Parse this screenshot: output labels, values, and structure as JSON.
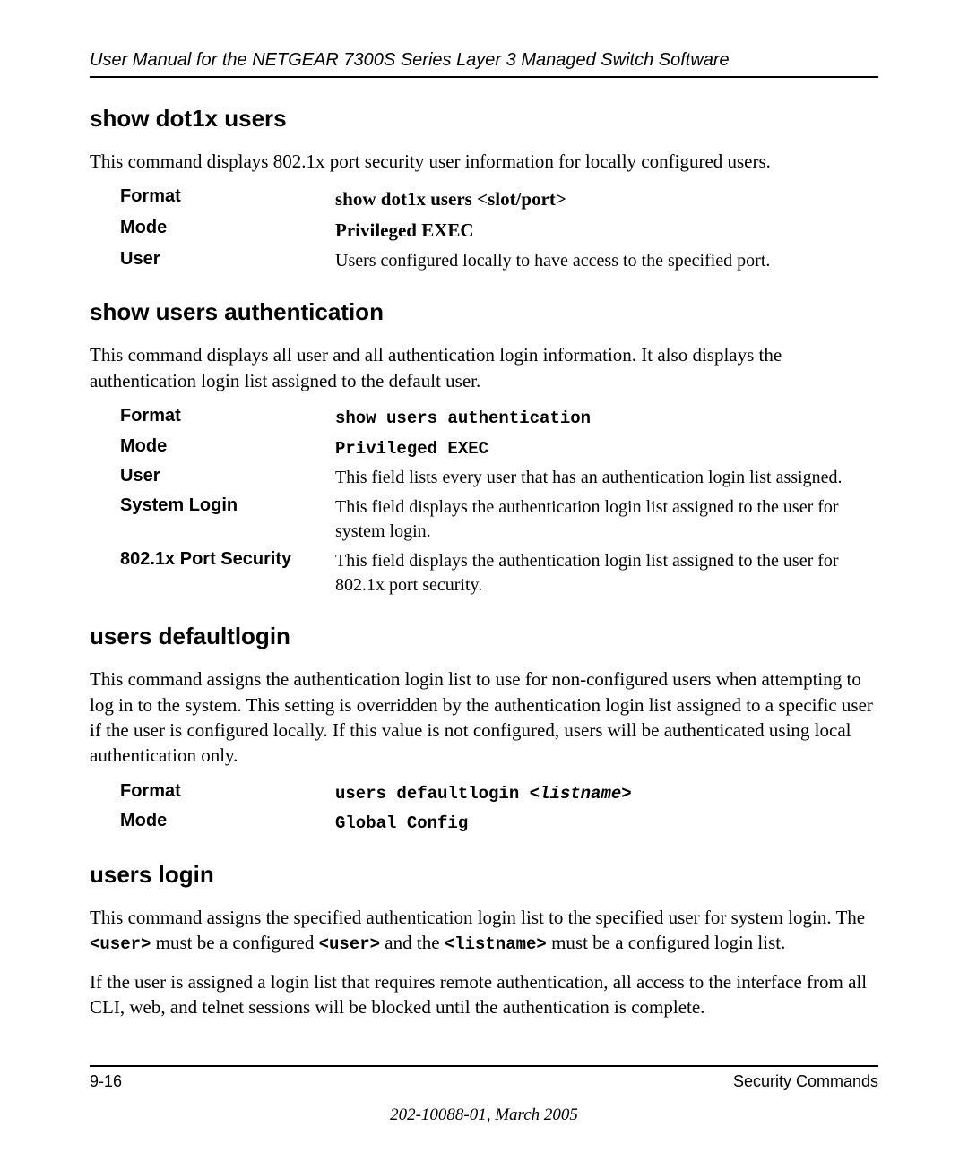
{
  "header": {
    "running_title": "User Manual for the NETGEAR 7300S Series Layer 3 Managed Switch Software"
  },
  "sections": {
    "show_dot1x_users": {
      "title": "show dot1x users",
      "intro": "This command displays 802.1x port security user information for locally configured users.",
      "rows": {
        "format_label": "Format",
        "format_value": "show dot1x users <slot/port>",
        "mode_label": "Mode",
        "mode_value": "Privileged EXEC",
        "user_label": "User",
        "user_value": "Users configured locally to have access to the specified port."
      }
    },
    "show_users_auth": {
      "title": "show users authentication",
      "intro": "This command displays all user and all authentication login information. It also displays the authentication login list assigned to the default user.",
      "rows": {
        "format_label": "Format",
        "format_value": "show users authentication",
        "mode_label": "Mode",
        "mode_value": "Privileged EXEC",
        "user_label": "User",
        "user_value": "This field lists every user that has an authentication login list assigned.",
        "syslogin_label": "System Login",
        "syslogin_value": "This field displays the authentication login list assigned to the user for system login.",
        "portsec_label": "802.1x Port Security",
        "portsec_value": "This field displays the authentication login list assigned to the user for 802.1x port security."
      }
    },
    "users_defaultlogin": {
      "title": "users defaultlogin",
      "intro": "This command assigns the authentication login list to use for non-configured users when attempting to log in to the system. This setting is overridden by the authentication login list assigned to a specific user if the user is configured locally. If this value is not configured, users will be authenticated using local authentication only.",
      "rows": {
        "format_label": "Format",
        "format_prefix": "users defaultlogin ",
        "format_arg": "<listname>",
        "mode_label": "Mode",
        "mode_value": "Global Config"
      }
    },
    "users_login": {
      "title": "users login",
      "para1_parts": {
        "a": "This command assigns the specified authentication login list to the specified user for system login. The ",
        "b": "<user>",
        "c": " must be a configured ",
        "d": "<user>",
        "e": " and the ",
        "f": "<listname>",
        "g": " must be a configured login list."
      },
      "para2": "If the user is assigned a login list that requires remote authentication, all access to the interface from all CLI, web, and telnet sessions will be blocked until the authentication is complete."
    }
  },
  "footer": {
    "page_num": "9-16",
    "chapter": "Security Commands",
    "doc_id": "202-10088-01, March 2005"
  }
}
